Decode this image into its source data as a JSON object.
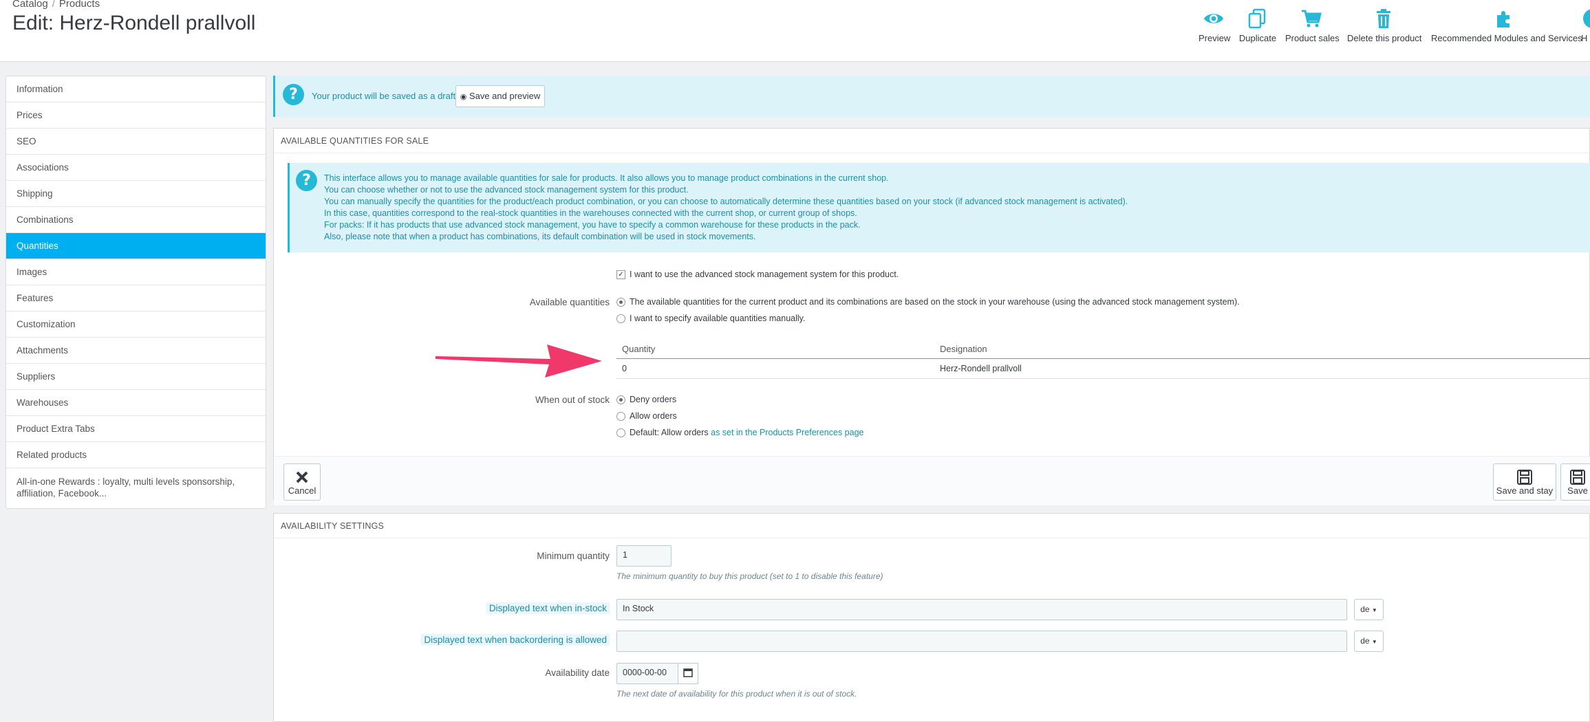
{
  "breadcrumb": {
    "catalog": "Catalog",
    "separator": "/",
    "products": "Products"
  },
  "page_title": "Edit: Herz-Rondell prallvoll",
  "toolbar": [
    {
      "label": "Preview",
      "icon": "eye-icon"
    },
    {
      "label": "Duplicate",
      "icon": "duplicate-icon"
    },
    {
      "label": "Product sales",
      "icon": "cart-icon"
    },
    {
      "label": "Delete this product",
      "icon": "trash-icon"
    },
    {
      "label": "Recommended Modules and Services",
      "icon": "puzzle-icon"
    },
    {
      "label": "H",
      "icon": "help-icon"
    }
  ],
  "sidebar": {
    "items": [
      {
        "label": "Information"
      },
      {
        "label": "Prices"
      },
      {
        "label": "SEO"
      },
      {
        "label": "Associations"
      },
      {
        "label": "Shipping"
      },
      {
        "label": "Combinations"
      },
      {
        "label": "Quantities",
        "active": true
      },
      {
        "label": "Images"
      },
      {
        "label": "Features"
      },
      {
        "label": "Customization"
      },
      {
        "label": "Attachments"
      },
      {
        "label": "Suppliers"
      },
      {
        "label": "Warehouses"
      },
      {
        "label": "Product Extra Tabs"
      },
      {
        "label": "Related products"
      },
      {
        "label": "All-in-one Rewards : loyalty, multi levels sponsorship, affiliation, Facebook..."
      }
    ]
  },
  "draft_alert": {
    "text": "Your product will be saved as a draft.",
    "button": "Save and preview"
  },
  "quantities_panel": {
    "heading": "Available quantities for sale",
    "info_lines": [
      "This interface allows you to manage available quantities for sale for products. It also allows you to manage product combinations in the current shop.",
      "You can choose whether or not to use the advanced stock management system for this product.",
      "You can manually specify the quantities for the product/each product combination, or you can choose to automatically determine these quantities based on your stock (if advanced stock management is activated).",
      "In this case, quantities correspond to the real-stock quantities in the warehouses connected with the current shop, or current group of shops.",
      "For packs: If it has products that use advanced stock management, you have to specify a common warehouse for these products in the pack.",
      "Also, please note that when a product has combinations, its default combination will be used in stock movements."
    ],
    "advanced_stock_checkbox": "I want to use the advanced stock management system for this product.",
    "available_quantities_label": "Available quantities",
    "qty_options": [
      "The available quantities for the current product and its combinations are based on the stock in your warehouse (using the advanced stock management system).",
      "I want to specify available quantities manually."
    ],
    "table": {
      "headers": [
        "Quantity",
        "Designation"
      ],
      "rows": [
        [
          "0",
          "Herz-Rondell prallvoll"
        ]
      ]
    },
    "out_of_stock_label": "When out of stock",
    "out_of_stock_options": [
      "Deny orders",
      "Allow orders",
      "Default: Allow orders"
    ],
    "preferences_link": "as set in the Products Preferences page",
    "footer": {
      "cancel": "Cancel",
      "save_and_stay": "Save and stay",
      "save": "Save"
    }
  },
  "availability_panel": {
    "heading": "Availability settings",
    "min_qty_label": "Minimum quantity",
    "min_qty_value": "1",
    "min_qty_hint": "The minimum quantity to buy this product (set to 1 to disable this feature)",
    "in_stock_label": "Displayed text when in-stock",
    "in_stock_value": "In Stock",
    "backorder_label": "Displayed text when backordering is allowed",
    "backorder_value": "",
    "lang": "de",
    "availability_date_label": "Availability date",
    "availability_date_value": "0000-00-00",
    "availability_date_hint": "The next date of availability for this product when it is out of stock."
  },
  "colors": {
    "accent": "#25b9d7",
    "active": "#00aff0",
    "arrow": "#f0386b"
  }
}
